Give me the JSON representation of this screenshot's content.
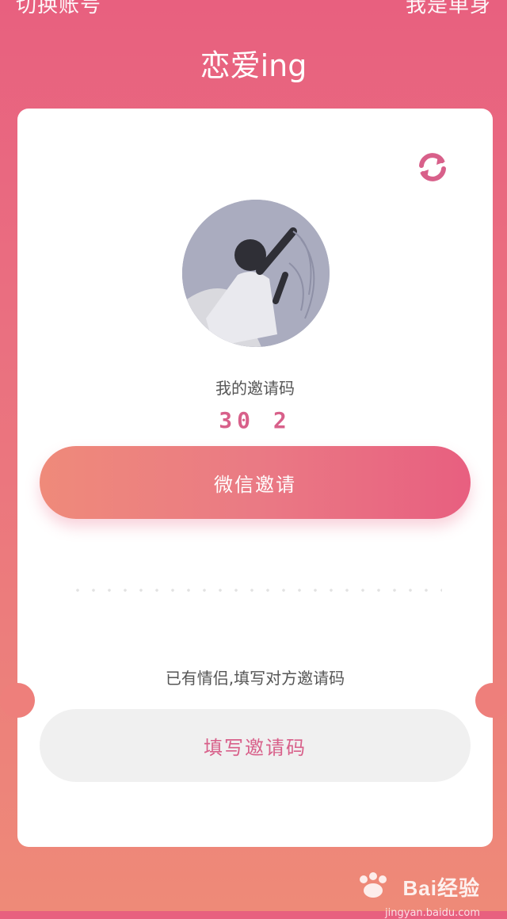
{
  "header": {
    "left_text": "切换账号",
    "right_text": "我是单身",
    "title": "恋爱ing"
  },
  "card": {
    "refresh_icon": "refresh-icon",
    "code_label": "我的邀请码",
    "invite_code": "30 2",
    "wechat_button": "微信邀请",
    "partner_hint": "已有情侣,填写对方邀请码",
    "fill_button": "填写邀请码"
  },
  "watermark": {
    "main": "Bai经验",
    "sub": "jingyan.baidu.com"
  },
  "colors": {
    "accent": "#d8608a",
    "gradient_start": "#e8607f",
    "gradient_end": "#ee8a78",
    "button_gray": "#f0f0f0"
  }
}
